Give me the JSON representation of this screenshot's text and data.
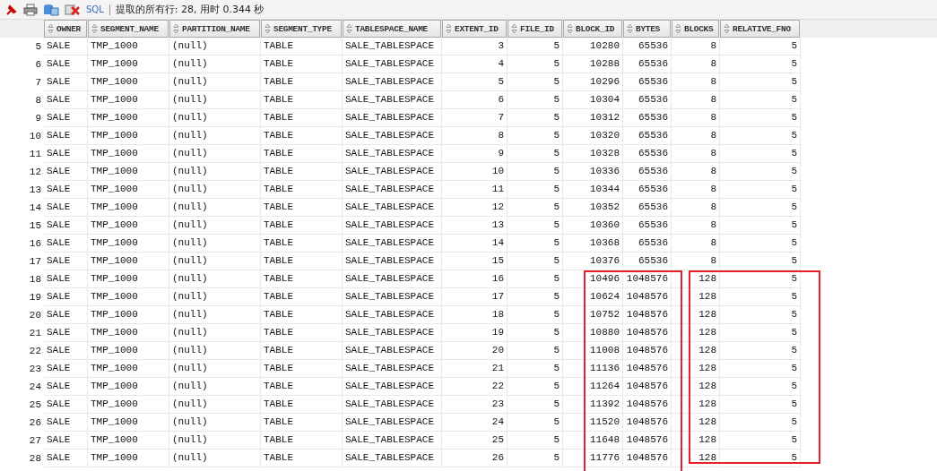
{
  "toolbar": {
    "sql_link": "SQL",
    "status": "提取的所有行: 28, 用时 0.344 秒"
  },
  "table": {
    "columns": [
      "OWNER",
      "SEGMENT_NAME",
      "PARTITION_NAME",
      "SEGMENT_TYPE",
      "TABLESPACE_NAME",
      "EXTENT_ID",
      "FILE_ID",
      "BLOCK_ID",
      "BYTES",
      "BLOCKS",
      "RELATIVE_FNO"
    ],
    "rows": [
      {
        "number": "5",
        "cells": [
          "SALE",
          "TMP_1000",
          "(null)",
          "TABLE",
          "SALE_TABLESPACE",
          "3",
          "5",
          "10280",
          "65536",
          "8",
          "5"
        ]
      },
      {
        "number": "6",
        "cells": [
          "SALE",
          "TMP_1000",
          "(null)",
          "TABLE",
          "SALE_TABLESPACE",
          "4",
          "5",
          "10288",
          "65536",
          "8",
          "5"
        ]
      },
      {
        "number": "7",
        "cells": [
          "SALE",
          "TMP_1000",
          "(null)",
          "TABLE",
          "SALE_TABLESPACE",
          "5",
          "5",
          "10296",
          "65536",
          "8",
          "5"
        ]
      },
      {
        "number": "8",
        "cells": [
          "SALE",
          "TMP_1000",
          "(null)",
          "TABLE",
          "SALE_TABLESPACE",
          "6",
          "5",
          "10304",
          "65536",
          "8",
          "5"
        ]
      },
      {
        "number": "9",
        "cells": [
          "SALE",
          "TMP_1000",
          "(null)",
          "TABLE",
          "SALE_TABLESPACE",
          "7",
          "5",
          "10312",
          "65536",
          "8",
          "5"
        ]
      },
      {
        "number": "10",
        "cells": [
          "SALE",
          "TMP_1000",
          "(null)",
          "TABLE",
          "SALE_TABLESPACE",
          "8",
          "5",
          "10320",
          "65536",
          "8",
          "5"
        ]
      },
      {
        "number": "11",
        "cells": [
          "SALE",
          "TMP_1000",
          "(null)",
          "TABLE",
          "SALE_TABLESPACE",
          "9",
          "5",
          "10328",
          "65536",
          "8",
          "5"
        ]
      },
      {
        "number": "12",
        "cells": [
          "SALE",
          "TMP_1000",
          "(null)",
          "TABLE",
          "SALE_TABLESPACE",
          "10",
          "5",
          "10336",
          "65536",
          "8",
          "5"
        ]
      },
      {
        "number": "13",
        "cells": [
          "SALE",
          "TMP_1000",
          "(null)",
          "TABLE",
          "SALE_TABLESPACE",
          "11",
          "5",
          "10344",
          "65536",
          "8",
          "5"
        ]
      },
      {
        "number": "14",
        "cells": [
          "SALE",
          "TMP_1000",
          "(null)",
          "TABLE",
          "SALE_TABLESPACE",
          "12",
          "5",
          "10352",
          "65536",
          "8",
          "5"
        ]
      },
      {
        "number": "15",
        "cells": [
          "SALE",
          "TMP_1000",
          "(null)",
          "TABLE",
          "SALE_TABLESPACE",
          "13",
          "5",
          "10360",
          "65536",
          "8",
          "5"
        ]
      },
      {
        "number": "16",
        "cells": [
          "SALE",
          "TMP_1000",
          "(null)",
          "TABLE",
          "SALE_TABLESPACE",
          "14",
          "5",
          "10368",
          "65536",
          "8",
          "5"
        ]
      },
      {
        "number": "17",
        "cells": [
          "SALE",
          "TMP_1000",
          "(null)",
          "TABLE",
          "SALE_TABLESPACE",
          "15",
          "5",
          "10376",
          "65536",
          "8",
          "5"
        ]
      },
      {
        "number": "18",
        "cells": [
          "SALE",
          "TMP_1000",
          "(null)",
          "TABLE",
          "SALE_TABLESPACE",
          "16",
          "5",
          "10496",
          "1048576",
          "128",
          "5"
        ]
      },
      {
        "number": "19",
        "cells": [
          "SALE",
          "TMP_1000",
          "(null)",
          "TABLE",
          "SALE_TABLESPACE",
          "17",
          "5",
          "10624",
          "1048576",
          "128",
          "5"
        ]
      },
      {
        "number": "20",
        "cells": [
          "SALE",
          "TMP_1000",
          "(null)",
          "TABLE",
          "SALE_TABLESPACE",
          "18",
          "5",
          "10752",
          "1048576",
          "128",
          "5"
        ]
      },
      {
        "number": "21",
        "cells": [
          "SALE",
          "TMP_1000",
          "(null)",
          "TABLE",
          "SALE_TABLESPACE",
          "19",
          "5",
          "10880",
          "1048576",
          "128",
          "5"
        ]
      },
      {
        "number": "22",
        "cells": [
          "SALE",
          "TMP_1000",
          "(null)",
          "TABLE",
          "SALE_TABLESPACE",
          "20",
          "5",
          "11008",
          "1048576",
          "128",
          "5"
        ]
      },
      {
        "number": "23",
        "cells": [
          "SALE",
          "TMP_1000",
          "(null)",
          "TABLE",
          "SALE_TABLESPACE",
          "21",
          "5",
          "11136",
          "1048576",
          "128",
          "5"
        ]
      },
      {
        "number": "24",
        "cells": [
          "SALE",
          "TMP_1000",
          "(null)",
          "TABLE",
          "SALE_TABLESPACE",
          "22",
          "5",
          "11264",
          "1048576",
          "128",
          "5"
        ]
      },
      {
        "number": "25",
        "cells": [
          "SALE",
          "TMP_1000",
          "(null)",
          "TABLE",
          "SALE_TABLESPACE",
          "23",
          "5",
          "11392",
          "1048576",
          "128",
          "5"
        ]
      },
      {
        "number": "26",
        "cells": [
          "SALE",
          "TMP_1000",
          "(null)",
          "TABLE",
          "SALE_TABLESPACE",
          "24",
          "5",
          "11520",
          "1048576",
          "128",
          "5"
        ]
      },
      {
        "number": "27",
        "cells": [
          "SALE",
          "TMP_1000",
          "(null)",
          "TABLE",
          "SALE_TABLESPACE",
          "25",
          "5",
          "11648",
          "1048576",
          "128",
          "5"
        ]
      },
      {
        "number": "28",
        "cells": [
          "SALE",
          "TMP_1000",
          "(null)",
          "TABLE",
          "SALE_TABLESPACE",
          "26",
          "5",
          "11776",
          "1048576",
          "128",
          "5"
        ]
      }
    ]
  },
  "annotations": [
    {
      "color": "#e8202a"
    },
    {
      "color": "#e8202a"
    }
  ]
}
